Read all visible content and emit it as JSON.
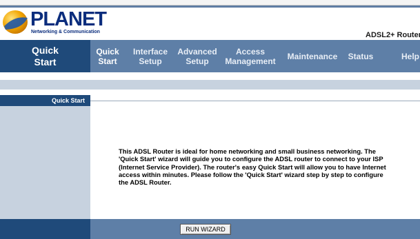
{
  "brand": {
    "logo_name": "PLANET",
    "logo_tagline": "Networking & Communication",
    "product": "ADSL2+ Router"
  },
  "nav": {
    "section_title": "Quick Start",
    "items": [
      {
        "label": "Quick Start",
        "active": true
      },
      {
        "label": "Interface Setup",
        "active": false
      },
      {
        "label": "Advanced Setup",
        "active": false
      },
      {
        "label": "Access Management",
        "active": false
      },
      {
        "label": "Maintenance",
        "active": false
      },
      {
        "label": "Status",
        "active": false
      },
      {
        "label": "Help",
        "active": false
      }
    ]
  },
  "sidebar": {
    "heading": "Quick Start"
  },
  "content": {
    "description": "This ADSL Router is ideal for home networking and small business networking. The 'Quick Start' wizard will guide you to configure the ADSL router to connect to your ISP (Internet Service Provider). The router's easy Quick Start will allow you to have Internet access within minutes. Please follow the 'Quick Start' wizard step by step to configure the ADSL Router."
  },
  "footer": {
    "run_wizard_label": "RUN WIZARD"
  },
  "colors": {
    "nav_dark": "#1f4a7a",
    "nav_mid": "#5e7fa7",
    "sidebar": "#c7d2df",
    "logo_blue": "#0b2d7d"
  }
}
